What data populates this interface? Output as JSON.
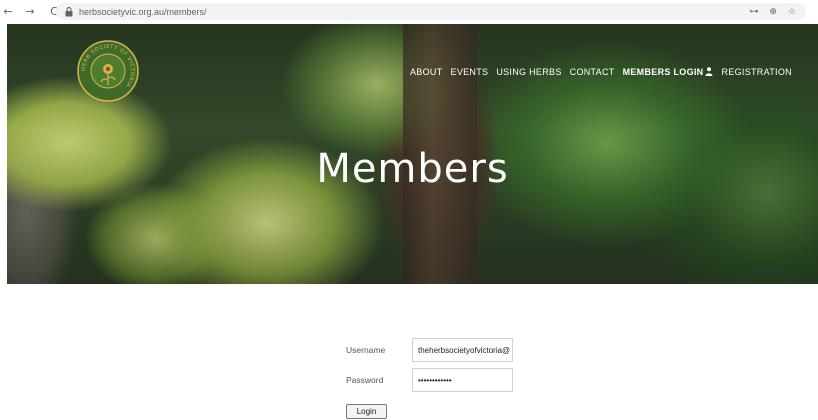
{
  "browser": {
    "back_glyph": "←",
    "forward_glyph": "→",
    "reload_glyph": "C",
    "url": "herbsocietyvic.org.au/members/",
    "key_glyph": "⊶",
    "share_glyph": "⊕",
    "star_glyph": "☆"
  },
  "nav": {
    "items": [
      {
        "label": "ABOUT"
      },
      {
        "label": "EVENTS"
      },
      {
        "label": "USING HERBS"
      },
      {
        "label": "CONTACT"
      },
      {
        "label": "MEMBERS LOGIN"
      },
      {
        "label": "REGISTRATION"
      }
    ]
  },
  "logo": {
    "text": "HERB SOCIETY OF VICTORIA"
  },
  "hero": {
    "title": "Members"
  },
  "form": {
    "username_label": "Username",
    "username_value": "theherbsocietyofvictoria@",
    "password_label": "Password",
    "password_value": "••••••••••••",
    "login_label": "Login"
  },
  "colors": {
    "nav_text": "#ffffff",
    "logo_green": "#3f6b2a",
    "logo_gold": "#d8b54a"
  }
}
